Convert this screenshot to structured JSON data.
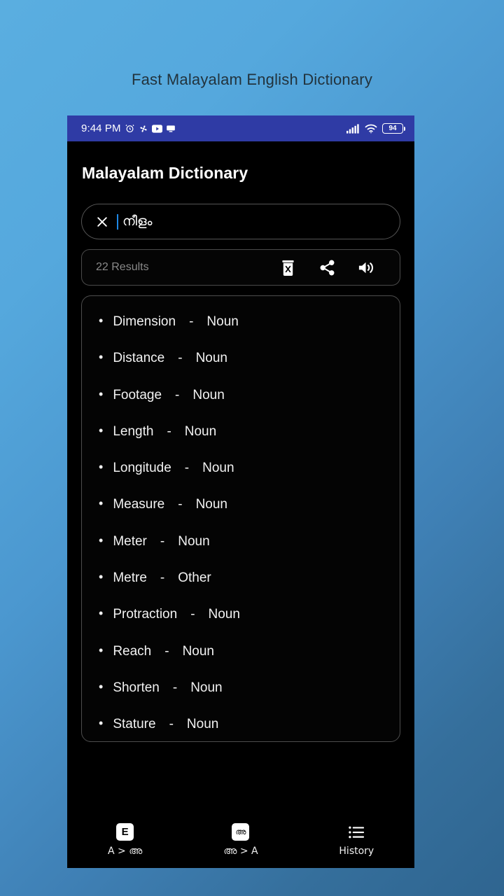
{
  "page": {
    "heading": "Fast Malayalam English Dictionary"
  },
  "status_bar": {
    "time": "9:44 PM",
    "icons_left": [
      "alarm-icon",
      "fan-icon",
      "youtube-icon",
      "desktop-icon"
    ],
    "icons_right": [
      "signal-icon",
      "wifi-icon"
    ],
    "battery_level": "94",
    "background_color": "#2f3ba5"
  },
  "app": {
    "title": "Malayalam Dictionary",
    "search": {
      "clear_icon": "close-x-icon",
      "value": "നീളം",
      "caret_color": "#1e88e5"
    },
    "results_bar": {
      "count_label": "22 Results",
      "actions": [
        {
          "name": "delete-button",
          "icon": "trash-delete-icon"
        },
        {
          "name": "share-button",
          "icon": "share-icon"
        },
        {
          "name": "speak-button",
          "icon": "volume-speaker-icon"
        }
      ]
    },
    "results": [
      {
        "word": "Dimension",
        "dash": "-",
        "pos": "Noun"
      },
      {
        "word": "Distance",
        "dash": "-",
        "pos": "Noun"
      },
      {
        "word": "Footage",
        "dash": "-",
        "pos": "Noun"
      },
      {
        "word": "Length",
        "dash": "-",
        "pos": "Noun"
      },
      {
        "word": "Longitude",
        "dash": "-",
        "pos": "Noun"
      },
      {
        "word": "Measure",
        "dash": "-",
        "pos": "Noun"
      },
      {
        "word": "Meter",
        "dash": "-",
        "pos": "Noun"
      },
      {
        "word": "Metre",
        "dash": "-",
        "pos": "Other"
      },
      {
        "word": "Protraction",
        "dash": "-",
        "pos": "Noun"
      },
      {
        "word": "Reach",
        "dash": "-",
        "pos": "Noun"
      },
      {
        "word": "Shorten",
        "dash": "-",
        "pos": "Noun"
      },
      {
        "word": "Stature",
        "dash": "-",
        "pos": "Noun"
      }
    ],
    "bottom_nav": [
      {
        "badge": "E",
        "label": "A > അ",
        "icon": "english-badge-icon"
      },
      {
        "badge": "അ",
        "label": "അ > A",
        "icon": "malayalam-badge-icon"
      },
      {
        "badge": "",
        "label": "History",
        "icon": "list-history-icon"
      }
    ]
  },
  "theme": {
    "app_background": "#000000",
    "accent": "#1e88e5",
    "page_gradient_start": "#5aaee0",
    "page_gradient_end": "#2f6590"
  }
}
